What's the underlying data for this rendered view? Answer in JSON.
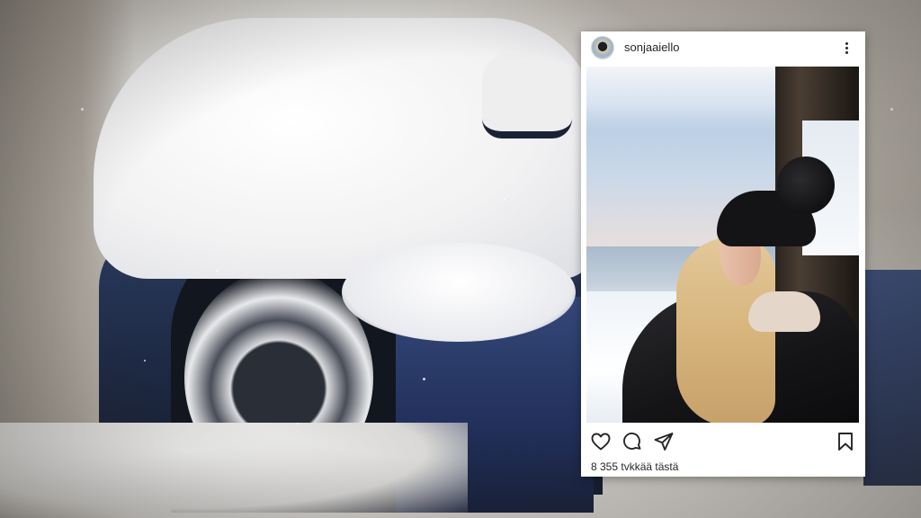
{
  "post": {
    "username": "sonjaaiello",
    "likes_text": "8 355 tvkkää tästä"
  },
  "icons": {
    "more": "more-options-icon",
    "like": "heart-icon",
    "comment": "comment-icon",
    "share": "send-icon",
    "save": "bookmark-icon"
  },
  "colors": {
    "card_background": "#ffffff",
    "text": "#262626"
  }
}
